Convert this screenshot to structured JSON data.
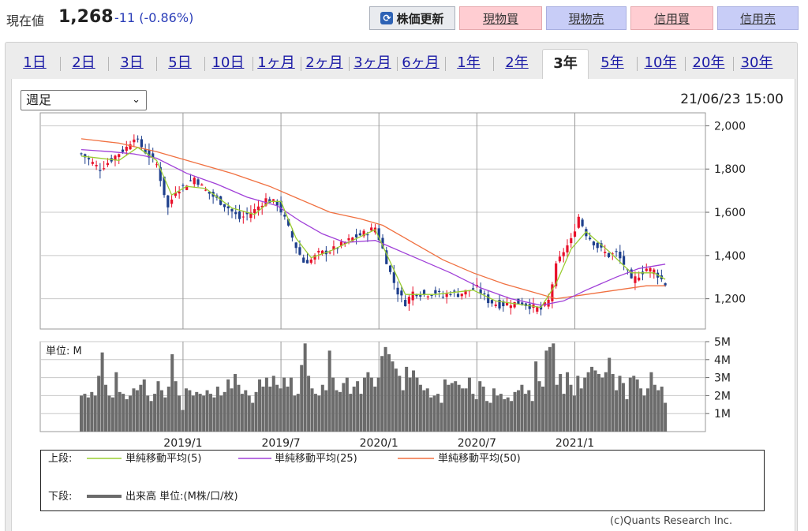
{
  "header": {
    "price_label": "現在値",
    "price_value": "1,268",
    "price_change": "-11 (-0.86%)",
    "refresh_label": "株価更新",
    "buttons": [
      "現物買",
      "現物売",
      "信用買",
      "信用売"
    ]
  },
  "tabs": {
    "items": [
      "1日",
      "2日",
      "3日",
      "5日",
      "10日",
      "1ヶ月",
      "2ヶ月",
      "3ヶ月",
      "6ヶ月",
      "1年",
      "2年",
      "3年",
      "5年",
      "10年",
      "20年",
      "30年"
    ],
    "active": "3年"
  },
  "period_select": {
    "value": "週足"
  },
  "timestamp": "21/06/23 15:00",
  "legend": {
    "upper_label": "上段:",
    "ma5": "単純移動平均(5)",
    "ma25": "単純移動平均(25)",
    "ma50": "単純移動平均(50)",
    "lower_label": "下段:",
    "volume": "出来高 単位:(M株/口/枚)"
  },
  "copyright": "(c)Quants Research Inc.",
  "colors": {
    "up": "#e8102a",
    "down": "#1e3f8c",
    "ma5": "#9acd32",
    "ma25": "#a040d8",
    "ma50": "#f07040",
    "volume": "#6b6b6b",
    "grid": "#c8c8c8"
  },
  "chart_data": [
    {
      "type": "candlestick",
      "frequency": "weekly",
      "y_ticks": [
        "2,000",
        "1,800",
        "1,600",
        "1,400",
        "1,200"
      ],
      "ylim": [
        1060,
        2060
      ],
      "x_start": "2018-06-25",
      "weeks": 156,
      "close_path": [
        [
          0,
          1870
        ],
        [
          5,
          1800
        ],
        [
          9,
          1860
        ],
        [
          12,
          1900
        ],
        [
          14,
          1950
        ],
        [
          17,
          1880
        ],
        [
          20,
          1820
        ],
        [
          23,
          1620
        ],
        [
          25,
          1700
        ],
        [
          27,
          1720
        ],
        [
          30,
          1760
        ],
        [
          33,
          1700
        ],
        [
          36,
          1660
        ],
        [
          39,
          1620
        ],
        [
          42,
          1570
        ],
        [
          46,
          1610
        ],
        [
          49,
          1660
        ],
        [
          52,
          1640
        ],
        [
          54,
          1570
        ],
        [
          57,
          1440
        ],
        [
          59,
          1370
        ],
        [
          61,
          1380
        ],
        [
          63,
          1410
        ],
        [
          66,
          1420
        ],
        [
          69,
          1450
        ],
        [
          72,
          1480
        ],
        [
          76,
          1510
        ],
        [
          78,
          1530
        ],
        [
          80,
          1430
        ],
        [
          82,
          1320
        ],
        [
          84,
          1230
        ],
        [
          86,
          1180
        ],
        [
          88,
          1230
        ],
        [
          91,
          1220
        ],
        [
          94,
          1230
        ],
        [
          96,
          1210
        ],
        [
          98,
          1230
        ],
        [
          100,
          1220
        ],
        [
          103,
          1240
        ],
        [
          105,
          1250
        ],
        [
          108,
          1190
        ],
        [
          111,
          1170
        ],
        [
          114,
          1180
        ],
        [
          117,
          1180
        ],
        [
          120,
          1160
        ],
        [
          122,
          1150
        ],
        [
          124,
          1190
        ],
        [
          126,
          1350
        ],
        [
          128,
          1420
        ],
        [
          130,
          1470
        ],
        [
          132,
          1580
        ],
        [
          134,
          1500
        ],
        [
          137,
          1440
        ],
        [
          140,
          1400
        ],
        [
          142,
          1410
        ],
        [
          144,
          1360
        ],
        [
          146,
          1280
        ],
        [
          148,
          1310
        ],
        [
          150,
          1340
        ],
        [
          152,
          1330
        ],
        [
          155,
          1268
        ]
      ],
      "ma5_path": [
        [
          0,
          1860
        ],
        [
          10,
          1840
        ],
        [
          15,
          1900
        ],
        [
          20,
          1840
        ],
        [
          24,
          1680
        ],
        [
          28,
          1720
        ],
        [
          33,
          1710
        ],
        [
          40,
          1620
        ],
        [
          46,
          1590
        ],
        [
          50,
          1650
        ],
        [
          53,
          1650
        ],
        [
          57,
          1480
        ],
        [
          61,
          1390
        ],
        [
          66,
          1420
        ],
        [
          72,
          1470
        ],
        [
          78,
          1520
        ],
        [
          82,
          1370
        ],
        [
          86,
          1220
        ],
        [
          94,
          1220
        ],
        [
          104,
          1240
        ],
        [
          110,
          1190
        ],
        [
          122,
          1160
        ],
        [
          126,
          1270
        ],
        [
          130,
          1430
        ],
        [
          134,
          1510
        ],
        [
          140,
          1420
        ],
        [
          146,
          1320
        ],
        [
          152,
          1320
        ],
        [
          155,
          1290
        ]
      ],
      "ma25_path": [
        [
          0,
          1890
        ],
        [
          8,
          1880
        ],
        [
          14,
          1870
        ],
        [
          20,
          1850
        ],
        [
          28,
          1780
        ],
        [
          36,
          1730
        ],
        [
          44,
          1670
        ],
        [
          52,
          1630
        ],
        [
          58,
          1560
        ],
        [
          64,
          1500
        ],
        [
          70,
          1460
        ],
        [
          78,
          1470
        ],
        [
          82,
          1440
        ],
        [
          90,
          1380
        ],
        [
          98,
          1320
        ],
        [
          106,
          1250
        ],
        [
          114,
          1200
        ],
        [
          122,
          1170
        ],
        [
          128,
          1190
        ],
        [
          134,
          1240
        ],
        [
          142,
          1300
        ],
        [
          148,
          1340
        ],
        [
          155,
          1360
        ]
      ],
      "ma50_path": [
        [
          0,
          1940
        ],
        [
          10,
          1920
        ],
        [
          20,
          1880
        ],
        [
          30,
          1830
        ],
        [
          40,
          1780
        ],
        [
          50,
          1720
        ],
        [
          58,
          1660
        ],
        [
          66,
          1600
        ],
        [
          74,
          1570
        ],
        [
          80,
          1540
        ],
        [
          88,
          1460
        ],
        [
          96,
          1380
        ],
        [
          104,
          1320
        ],
        [
          112,
          1270
        ],
        [
          120,
          1230
        ],
        [
          126,
          1200
        ],
        [
          134,
          1220
        ],
        [
          142,
          1240
        ],
        [
          150,
          1260
        ],
        [
          155,
          1260
        ]
      ]
    },
    {
      "type": "bar",
      "title": "単位: M",
      "y_ticks": [
        "5M",
        "4M",
        "3M",
        "2M",
        "1M"
      ],
      "ylim": [
        0,
        5
      ],
      "x_ticks": [
        "2019/1",
        "2019/7",
        "2020/1",
        "2020/7",
        "2021/1"
      ],
      "x_tick_weeks": [
        27,
        53,
        79,
        105,
        131
      ],
      "volumes": [
        2.0,
        2.1,
        1.9,
        2.2,
        2.0,
        3.1,
        4.4,
        2.6,
        2.0,
        1.9,
        3.3,
        2.2,
        2.1,
        1.8,
        2.0,
        2.4,
        2.3,
        2.6,
        2.9,
        2.0,
        1.7,
        2.1,
        2.8,
        2.3,
        1.9,
        2.5,
        4.3,
        2.8,
        2.0,
        1.2,
        2.4,
        2.3,
        2.0,
        2.2,
        2.1,
        2.0,
        2.3,
        2.1,
        1.9,
        2.5,
        2.0,
        2.2,
        2.9,
        2.4,
        3.2,
        2.6,
        2.1,
        2.3,
        2.0,
        1.6,
        2.2,
        2.9,
        2.5,
        3.0,
        2.5,
        3.1,
        2.6,
        2.4,
        3.0,
        2.5,
        3.0,
        2.0,
        2.1,
        3.7,
        4.9,
        3.1,
        2.4,
        2.1,
        2.0,
        2.6,
        2.3,
        4.5,
        3.0,
        2.3,
        2.2,
        2.7,
        3.0,
        2.1,
        2.5,
        2.8,
        2.1,
        3.0,
        3.3,
        3.0,
        2.5,
        3.0,
        4.2,
        4.7,
        4.3,
        3.9,
        3.5,
        3.1,
        2.3,
        3.6,
        3.0,
        3.4,
        3.0,
        2.6,
        2.3,
        2.4,
        1.9,
        2.0,
        2.1,
        1.6,
        2.9,
        2.6,
        2.7,
        2.8,
        2.6,
        2.4,
        2.4,
        3.0,
        2.1,
        1.8,
        2.8,
        2.5,
        1.7,
        1.6,
        2.4,
        2.0,
        2.1,
        1.8,
        1.9,
        1.7,
        2.2,
        2.3,
        2.6,
        2.1,
        2.3,
        1.7,
        3.9,
        2.8,
        2.5,
        4.5,
        4.7,
        4.9,
        2.6,
        3.2,
        2.1,
        3.3,
        2.6,
        2.0,
        3.1,
        2.4,
        3.0,
        3.3,
        3.6,
        3.4,
        3.2,
        3.0,
        3.3,
        4.1,
        3.2,
        2.3,
        3.1,
        2.7,
        1.8,
        3.0,
        3.1,
        2.9,
        2.4,
        2.0,
        2.4,
        3.3,
        2.6,
        2.3,
        2.5,
        1.6
      ]
    }
  ]
}
